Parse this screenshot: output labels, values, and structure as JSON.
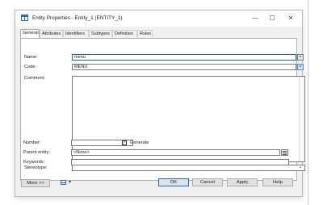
{
  "window": {
    "title": "Entity Properties - Entity_1 (ENTITY_1)",
    "minimize_glyph": "—",
    "maximize_glyph": "☐",
    "close_glyph": "✕"
  },
  "tabs": [
    {
      "label": "General"
    },
    {
      "label": "Attributes"
    },
    {
      "label": "Identifiers"
    },
    {
      "label": "Subtypes"
    },
    {
      "label": "Definition"
    },
    {
      "label": "Rules"
    }
  ],
  "form": {
    "name_label": "Name:",
    "name_value": "menu",
    "code_label": "Code:",
    "code_value": "MENU",
    "comment_label": "Comment:",
    "comment_value": "",
    "stereotype_label": "Stereotype:",
    "stereotype_value": "",
    "number_label": "Number:",
    "number_value": "",
    "generate_label": "Generate",
    "generate_checked": true,
    "parent_entity_label": "Parent entity:",
    "parent_entity_value": "<None>",
    "keywords_label": "Keywords:",
    "keywords_value": "",
    "equals_glyph": "=",
    "dropdown_glyph": "⌄"
  },
  "buttons": {
    "more": "More >>",
    "ok": "OK",
    "cancel": "Cancel",
    "apply": "Apply",
    "help": "Help",
    "print_dropdown_glyph": "▾"
  },
  "colors": {
    "accent": "#0078d7",
    "icon_blue": "#2a6fb8"
  }
}
